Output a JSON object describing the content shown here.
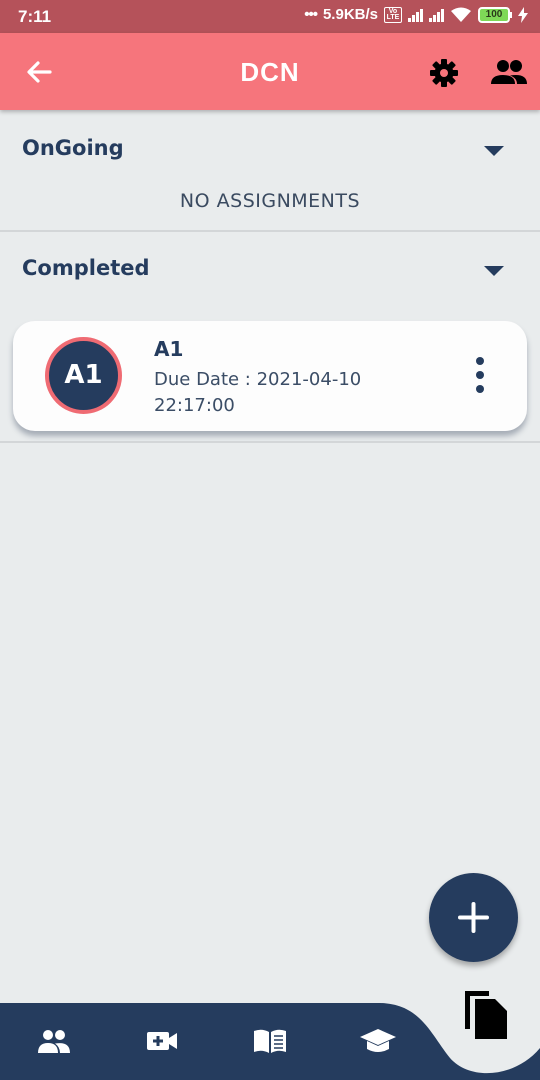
{
  "status_bar": {
    "time": "7:11",
    "network_speed": "5.9KB/s",
    "volte_label": "Vo LTE",
    "battery": "100"
  },
  "app_bar": {
    "title": "DCN",
    "back_icon": "arrow-back-icon",
    "settings_icon": "gear-icon",
    "members_icon": "people-icon"
  },
  "sections": {
    "ongoing": {
      "label": "OnGoing",
      "empty_message": "NO ASSIGNMENTS"
    },
    "completed": {
      "label": "Completed",
      "items": [
        {
          "avatar": "A1",
          "name": "A1",
          "due_label": "Due Date :",
          "due_value": "2021-04-10 22:17:00"
        }
      ]
    }
  },
  "fab": {
    "icon": "plus-icon"
  },
  "bottom_nav": {
    "items": [
      "people-icon",
      "video-add-icon",
      "book-icon",
      "graduation-cap-icon"
    ],
    "floating_icon": "copy-document-icon"
  },
  "colors": {
    "app_bar": "#f6757c",
    "status_bar": "#b5525a",
    "primary_navy": "#253c5e",
    "avatar_ring": "#ef6b73",
    "background": "#e9eced"
  }
}
